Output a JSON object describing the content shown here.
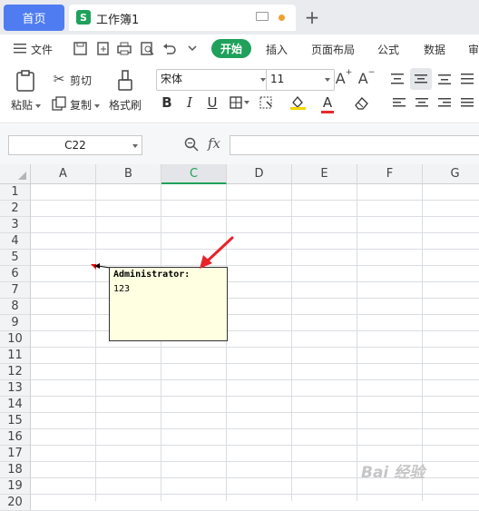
{
  "tabs": {
    "home_label": "首页",
    "doc_title": "工作簿1",
    "doc_icon_letter": "S",
    "new_tab": "+"
  },
  "menu": {
    "file": "文件",
    "tabs": [
      "开始",
      "插入",
      "页面布局",
      "公式",
      "数据",
      "审"
    ],
    "active_tab": "开始"
  },
  "ribbon": {
    "paste": "粘贴",
    "cut": "剪切",
    "copy": "复制",
    "format_painter": "格式刷",
    "font_name": "宋体",
    "font_size": "11"
  },
  "formula_bar": {
    "name_box": "C22",
    "fx": "fx",
    "formula": ""
  },
  "grid": {
    "columns": [
      "A",
      "B",
      "C",
      "D",
      "E",
      "F",
      "G"
    ],
    "selected_column": "C",
    "rows": [
      "1",
      "2",
      "3",
      "4",
      "5",
      "6",
      "7",
      "8",
      "9",
      "10",
      "11",
      "12",
      "13",
      "14",
      "15",
      "16",
      "17",
      "18",
      "19",
      "20"
    ]
  },
  "comment": {
    "author": "Administrator:",
    "text": "123"
  },
  "watermark": "Bai 经验",
  "colors": {
    "accent_green": "#1fa15b",
    "home_tab_blue": "#4f7cf0",
    "comment_bg": "#ffffe1",
    "arrow_red": "#e8222a"
  },
  "icons": [
    "save-icon",
    "export-icon",
    "print-icon",
    "preview-icon",
    "undo-icon",
    "paste-icon",
    "cut-icon",
    "copy-icon",
    "format-painter-icon",
    "zoom-icon",
    "bold-icon",
    "italic-icon",
    "underline-icon",
    "border-icon",
    "fill-color-icon",
    "font-color-icon",
    "eraser-icon",
    "align-icon"
  ]
}
